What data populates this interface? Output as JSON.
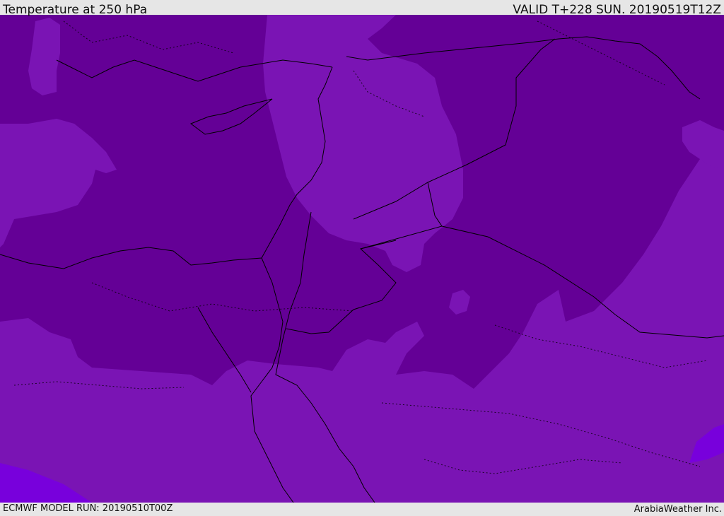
{
  "header": {
    "title": "Temperature at 250 hPa",
    "valid": "VALID T+228 SUN. 20190519T12Z"
  },
  "footer": {
    "model_run": "ECMWF MODEL RUN: 20190510T00Z",
    "credit": "ArabiaWeather Inc."
  },
  "colors": {
    "dark_band": "#640096",
    "mid_band": "#7a14b4",
    "light_band": "#7800dc",
    "coast_line": "#000000",
    "header_bg": "#e6e6e6"
  }
}
